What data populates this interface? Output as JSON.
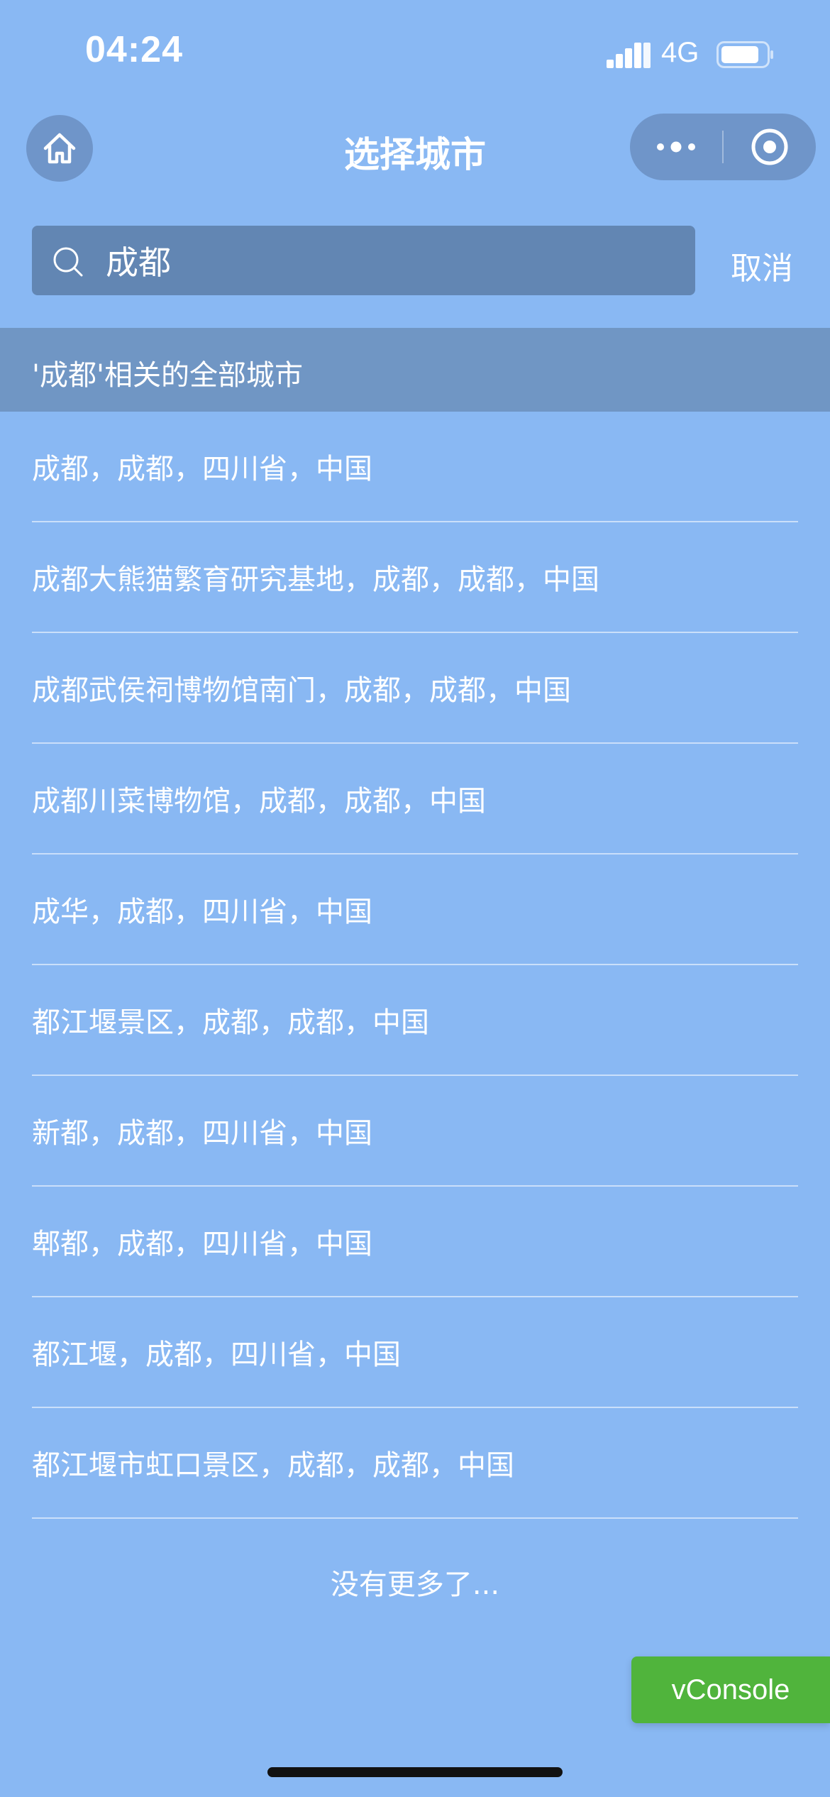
{
  "status_bar": {
    "time": "04:24",
    "network": "4G"
  },
  "nav": {
    "title": "选择城市"
  },
  "search": {
    "value": "成都",
    "cancel_label": "取消"
  },
  "results": {
    "header": "'成都'相关的全部城市",
    "items": [
      "成都，成都，四川省，中国",
      "成都大熊猫繁育研究基地，成都，成都，中国",
      "成都武侯祠博物馆南门，成都，成都，中国",
      "成都川菜博物馆，成都，成都，中国",
      "成华，成都，四川省，中国",
      "都江堰景区，成都，成都，中国",
      "新都，成都，四川省，中国",
      "郫都，成都，四川省，中国",
      "都江堰，成都，四川省，中国",
      "都江堰市虹口景区，成都，成都，中国"
    ],
    "footer": "没有更多了..."
  },
  "vconsole": {
    "label": "vConsole"
  },
  "colors": {
    "background": "#89b8f3",
    "header_band": "#7096c4",
    "search_box": "#6286b3",
    "vconsole": "#50b43c"
  }
}
